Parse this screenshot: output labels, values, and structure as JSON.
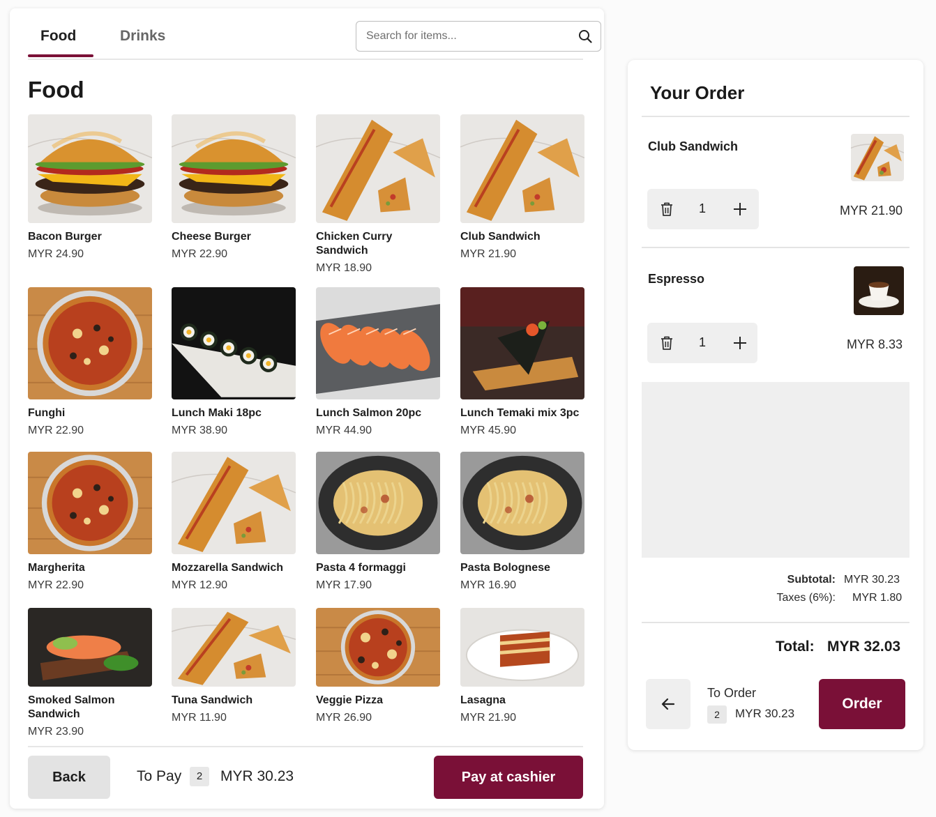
{
  "tabs": [
    {
      "label": "Food"
    },
    {
      "label": "Drinks"
    }
  ],
  "search": {
    "placeholder": "Search for items..."
  },
  "section_title": "Food",
  "menu_items": [
    {
      "name": "Bacon Burger",
      "price": "MYR 24.90",
      "image": "burger"
    },
    {
      "name": "Cheese Burger",
      "price": "MYR 22.90",
      "image": "burger"
    },
    {
      "name": "Chicken Curry Sandwich",
      "price": "MYR 18.90",
      "image": "sandwich"
    },
    {
      "name": "Club Sandwich",
      "price": "MYR 21.90",
      "image": "sandwich"
    },
    {
      "name": "Funghi",
      "price": "MYR 22.90",
      "image": "pizza"
    },
    {
      "name": "Lunch Maki 18pc",
      "price": "MYR 38.90",
      "image": "maki"
    },
    {
      "name": "Lunch Salmon 20pc",
      "price": "MYR 44.90",
      "image": "salmon"
    },
    {
      "name": "Lunch Temaki mix 3pc",
      "price": "MYR 45.90",
      "image": "temaki"
    },
    {
      "name": "Margherita",
      "price": "MYR 22.90",
      "image": "pizza"
    },
    {
      "name": "Mozzarella Sandwich",
      "price": "MYR 12.90",
      "image": "sandwich"
    },
    {
      "name": "Pasta 4 formaggi",
      "price": "MYR 17.90",
      "image": "pasta"
    },
    {
      "name": "Pasta Bolognese",
      "price": "MYR 16.90",
      "image": "pasta"
    },
    {
      "name": "Smoked Salmon Sandwich",
      "price": "MYR 23.90",
      "image": "salmon-sandwich"
    },
    {
      "name": "Tuna Sandwich",
      "price": "MYR 11.90",
      "image": "sandwich"
    },
    {
      "name": "Veggie Pizza",
      "price": "MYR 26.90",
      "image": "pizza"
    },
    {
      "name": "Lasagna",
      "price": "MYR 21.90",
      "image": "lasagna"
    }
  ],
  "bottom_bar": {
    "back_label": "Back",
    "to_pay_label": "To Pay",
    "to_pay_count": "2",
    "to_pay_amount": "MYR 30.23",
    "pay_label": "Pay at cashier"
  },
  "order": {
    "title": "Your Order",
    "items": [
      {
        "name": "Club Sandwich",
        "qty": "1",
        "price": "MYR 21.90",
        "image": "sandwich"
      },
      {
        "name": "Espresso",
        "qty": "1",
        "price": "MYR 8.33",
        "image": "espresso"
      }
    ],
    "subtotal_label": "Subtotal:",
    "subtotal_value": "MYR 30.23",
    "taxes_label": "Taxes (6%):",
    "taxes_value": "MYR 1.80",
    "total_label": "Total:",
    "total_value": "MYR 32.03",
    "to_order_label": "To Order",
    "to_order_count": "2",
    "to_order_amount": "MYR 30.23",
    "order_button": "Order"
  },
  "colors": {
    "accent": "#7a1037",
    "panel_gray": "#efefef"
  },
  "icons": [
    "search-icon",
    "trash-icon",
    "plus-icon",
    "arrow-left-icon"
  ]
}
